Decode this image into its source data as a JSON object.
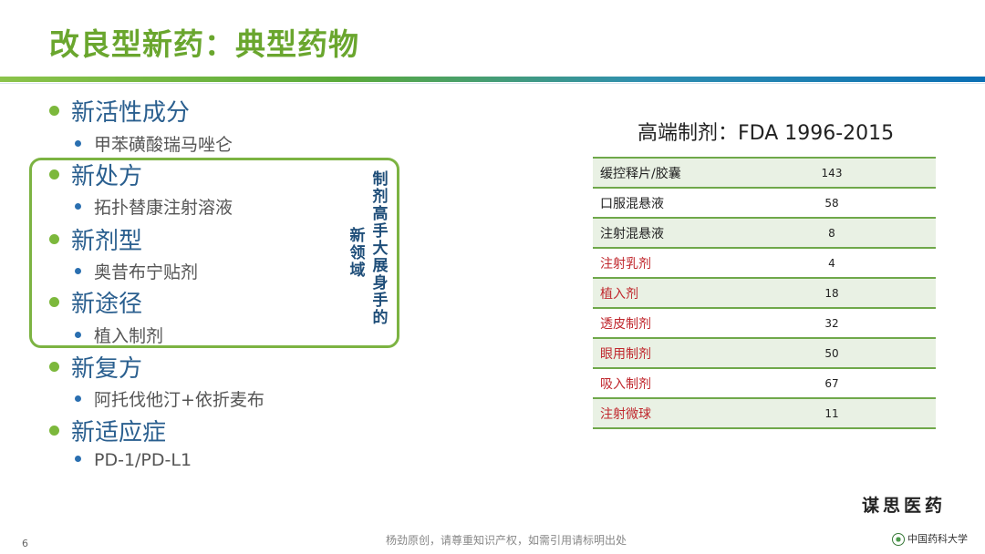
{
  "slide": {
    "title": "改良型新药：典型药物",
    "page_number": "6",
    "footer": "杨劲原创，请尊重知识产权，如需引用请标明出处",
    "brand": "谋思医药",
    "university": "中国药科大学"
  },
  "bullets": [
    {
      "heading": "新活性成分",
      "sub": "甲苯磺酸瑞马唑仑"
    },
    {
      "heading": "新处方",
      "sub": "拓扑替康注射溶液"
    },
    {
      "heading": "新剂型",
      "sub": "奥昔布宁贴剂"
    },
    {
      "heading": "新途径",
      "sub": "植入制剂"
    },
    {
      "heading": "新复方",
      "sub": "阿托伐他汀+依折麦布"
    },
    {
      "heading": "新适应症",
      "sub": "PD-1/PD-L1"
    }
  ],
  "callout": {
    "col1": "新领域",
    "col2": "制剂高手大展身手的"
  },
  "table": {
    "title": "高端制剂：FDA 1996-2015",
    "rows": [
      {
        "label": "缓控释片/胶囊",
        "value": "143",
        "highlight": false
      },
      {
        "label": "口服混悬液",
        "value": "58",
        "highlight": false
      },
      {
        "label": "注射混悬液",
        "value": "8",
        "highlight": false
      },
      {
        "label": "注射乳剂",
        "value": "4",
        "highlight": true
      },
      {
        "label": "植入剂",
        "value": "18",
        "highlight": true
      },
      {
        "label": "透皮制剂",
        "value": "32",
        "highlight": true
      },
      {
        "label": "眼用制剂",
        "value": "50",
        "highlight": true
      },
      {
        "label": "吸入制剂",
        "value": "67",
        "highlight": true
      },
      {
        "label": "注射微球",
        "value": "11",
        "highlight": true
      }
    ]
  },
  "colors": {
    "title": "#6aa62e",
    "heading": "#2a5f8f",
    "highlight_text": "#c0272d",
    "table_border": "#6fa84a"
  }
}
